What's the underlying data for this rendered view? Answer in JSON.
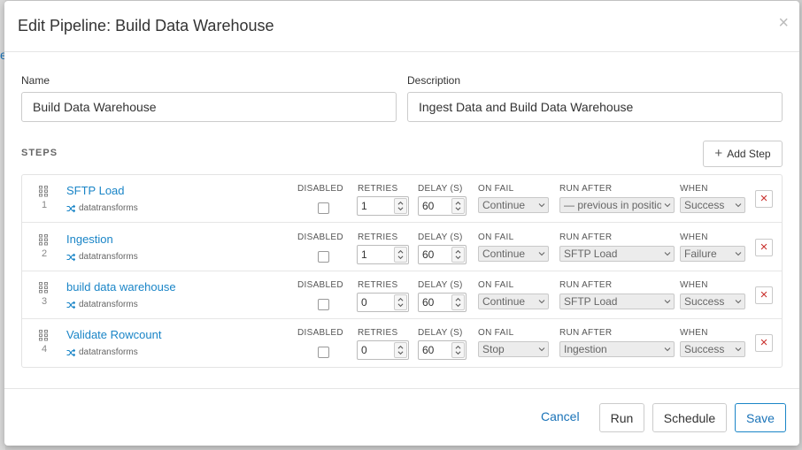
{
  "backdrop": {
    "link_fragment": "e"
  },
  "modal": {
    "title": "Edit Pipeline: Build Data Warehouse",
    "close_glyph": "×"
  },
  "form": {
    "name_label": "Name",
    "name_value": "Build Data Warehouse",
    "description_label": "Description",
    "description_value": "Ingest Data and Build Data Warehouse"
  },
  "steps_section": {
    "heading": "STEPS",
    "add_step_label": "Add Step",
    "columns": {
      "disabled": "DISABLED",
      "retries": "RETRIES",
      "delay": "DELAY (S)",
      "on_fail": "ON FAIL",
      "run_after": "RUN AFTER",
      "when": "WHEN"
    },
    "remove_glyph": "×",
    "steps": [
      {
        "number": "1",
        "name": "SFTP Load",
        "source": "datatransforms",
        "disabled": false,
        "retries": "1",
        "delay": "60",
        "on_fail": "Continue",
        "run_after": "— previous in position —",
        "when": "Success"
      },
      {
        "number": "2",
        "name": "Ingestion",
        "source": "datatransforms",
        "disabled": false,
        "retries": "1",
        "delay": "60",
        "on_fail": "Continue",
        "run_after": "SFTP Load",
        "when": "Failure"
      },
      {
        "number": "3",
        "name": "build data warehouse",
        "source": "datatransforms",
        "disabled": false,
        "retries": "0",
        "delay": "60",
        "on_fail": "Continue",
        "run_after": "SFTP Load",
        "when": "Success"
      },
      {
        "number": "4",
        "name": "Validate Rowcount",
        "source": "datatransforms",
        "disabled": false,
        "retries": "0",
        "delay": "60",
        "on_fail": "Stop",
        "run_after": "Ingestion",
        "when": "Success"
      }
    ]
  },
  "footer": {
    "cancel_label": "Cancel",
    "run_label": "Run",
    "schedule_label": "Schedule",
    "save_label": "Save"
  },
  "colors": {
    "link": "#1a73b8",
    "step_link": "#1a85c7",
    "remove": "#c9302c"
  },
  "icons": {
    "drag": "drag-handle-icon",
    "source": "shuffle-icon",
    "plus": "plus-icon",
    "close": "close-icon",
    "chevron": "chevron-down-icon",
    "stepper": "up-down-arrows-icon"
  }
}
